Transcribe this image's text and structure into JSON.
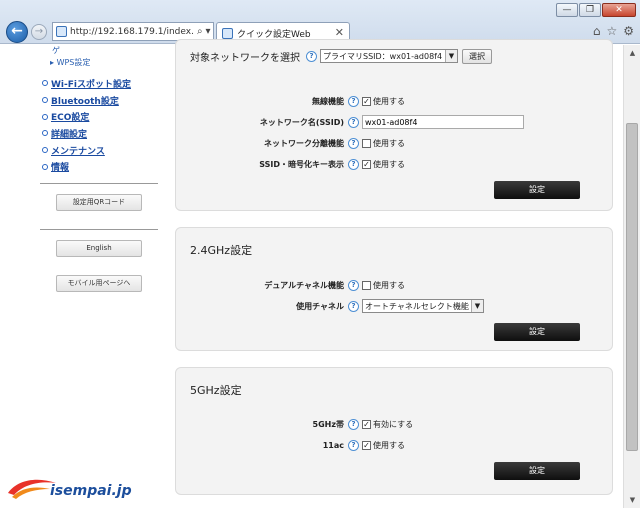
{
  "browser": {
    "address": "http://192.168.179.1/index.",
    "tab_title": "クイック設定Web",
    "win_minimize": "—",
    "win_restore": "❐",
    "win_close": "✕",
    "tab_close": "✕"
  },
  "sidebar": {
    "top_fragment": "ゲ",
    "wps_link": "WPS設定",
    "items": [
      {
        "label": "Wi-Fiスポット設定"
      },
      {
        "label": "Bluetooth設定"
      },
      {
        "label": "ECO設定"
      },
      {
        "label": "詳細設定"
      },
      {
        "label": "メンテナンス"
      },
      {
        "label": "情報"
      }
    ],
    "qr_button": "設定用QRコード",
    "english_button": "English",
    "mobile_button": "モバイル用ページへ"
  },
  "panel_wifi": {
    "network_select_label": "対象ネットワークを選択",
    "network_select_value": "プライマリSSID：wx01-ad08f4",
    "select_button": "選択",
    "rows": [
      {
        "label": "無線機能",
        "value": "使用する",
        "checked": true
      },
      {
        "label": "ネットワーク名(SSID)",
        "input_value": "wx01-ad08f4"
      },
      {
        "label": "ネットワーク分離機能",
        "value": "使用する",
        "checked": false
      },
      {
        "label": "SSID・暗号化キー表示",
        "value": "使用する",
        "checked": true
      }
    ],
    "submit": "設定"
  },
  "panel_24": {
    "title": "2.4GHz設定",
    "rows": [
      {
        "label": "デュアルチャネル機能",
        "value": "使用する",
        "checked": false
      },
      {
        "label": "使用チャネル",
        "select_value": "オートチャネルセレクト機能"
      }
    ],
    "submit": "設定"
  },
  "panel_5": {
    "title": "5GHz設定",
    "rows": [
      {
        "label": "5GHz帯",
        "value": "有効にする",
        "checked": true
      },
      {
        "label": "11ac",
        "value": "使用する",
        "checked": true
      }
    ],
    "submit": "設定"
  },
  "watermark": {
    "text": "isempai.jp"
  },
  "colors": {
    "link": "#1a4aa0",
    "button_dark": "#111111",
    "panel_bg": "#f3f3f3"
  }
}
